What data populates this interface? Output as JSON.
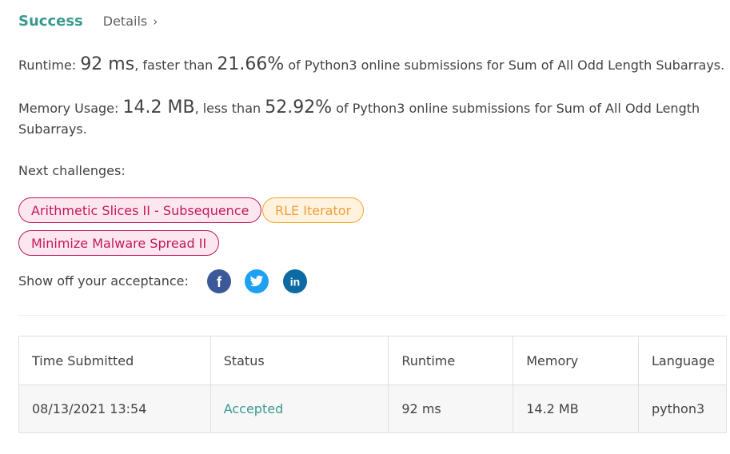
{
  "header": {
    "status": "Success",
    "details_label": "Details",
    "details_chevron": "›"
  },
  "runtime": {
    "label": "Runtime:",
    "value": "92 ms",
    "mid": ", faster than",
    "percent": "21.66%",
    "tail": "of Python3 online submissions for Sum of All Odd Length Subarrays."
  },
  "memory": {
    "label": "Memory Usage:",
    "value": "14.2 MB",
    "mid": ", less than",
    "percent": "52.92%",
    "tail": "of Python3 online submissions for Sum of All Odd Length Subarrays."
  },
  "next": {
    "label": "Next challenges:",
    "challenges": [
      {
        "title": "Arithmetic Slices II - Subsequence",
        "difficulty_color": "#c2185b"
      },
      {
        "title": "RLE Iterator",
        "difficulty_color": "#f5a623"
      },
      {
        "title": "Minimize Malware Spread II",
        "difficulty_color": "#c2185b"
      }
    ]
  },
  "share": {
    "label": "Show off your acceptance:",
    "icons": [
      "facebook-icon",
      "twitter-icon",
      "linkedin-icon"
    ]
  },
  "table": {
    "headers": [
      "Time Submitted",
      "Status",
      "Runtime",
      "Memory",
      "Language"
    ],
    "rows": [
      {
        "time": "08/13/2021 13:54",
        "status": "Accepted",
        "runtime": "92 ms",
        "memory": "14.2 MB",
        "language": "python3"
      }
    ]
  },
  "colors": {
    "accent": "#3a9a8f",
    "hard": "#c2185b",
    "medium": "#f5a623"
  }
}
